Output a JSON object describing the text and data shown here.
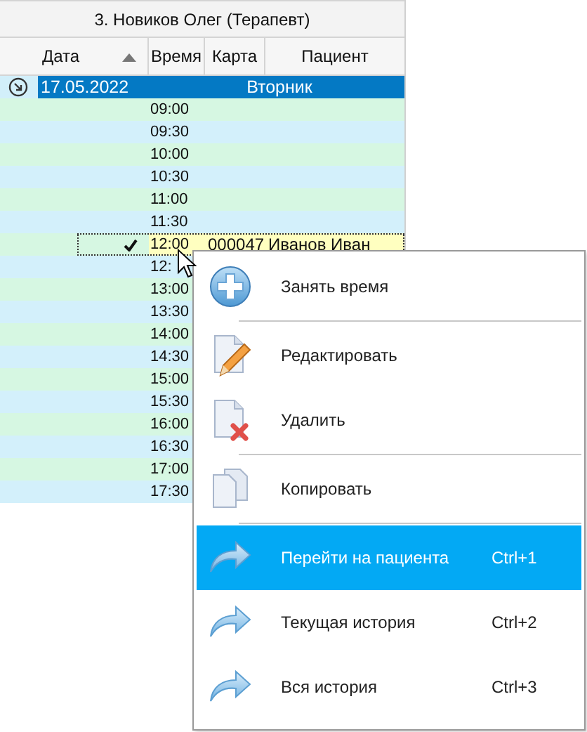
{
  "grid": {
    "title": "3. Новиков Олег (Терапевт)",
    "columns": [
      {
        "label": "Дата",
        "sorted": true
      },
      {
        "label": "Время",
        "sorted": false
      },
      {
        "label": "Карта",
        "sorted": false
      },
      {
        "label": "Пациент",
        "sorted": false
      }
    ],
    "group": {
      "date": "17.05.2022",
      "weekday": "Вторник",
      "selected": true
    },
    "rows": [
      {
        "time": "09:00",
        "selected": false,
        "checked": false
      },
      {
        "time": "09:30",
        "selected": false,
        "checked": false
      },
      {
        "time": "10:00",
        "selected": false,
        "checked": false
      },
      {
        "time": "10:30",
        "selected": false,
        "checked": false
      },
      {
        "time": "11:00",
        "selected": false,
        "checked": false
      },
      {
        "time": "11:30",
        "selected": false,
        "checked": false
      },
      {
        "time": "12:00",
        "card": "000047",
        "patient": "Иванов Иван",
        "selected": true,
        "checked": true
      },
      {
        "time": "12:",
        "selected": false,
        "checked": false
      },
      {
        "time": "13:00",
        "selected": false,
        "checked": false
      },
      {
        "time": "13:30",
        "selected": false,
        "checked": false
      },
      {
        "time": "14:00",
        "selected": false,
        "checked": false
      },
      {
        "time": "14:30",
        "selected": false,
        "checked": false
      },
      {
        "time": "15:00",
        "selected": false,
        "checked": false
      },
      {
        "time": "15:30",
        "selected": false,
        "checked": false
      },
      {
        "time": "16:00",
        "selected": false,
        "checked": false
      },
      {
        "time": "16:30",
        "selected": false,
        "checked": false
      },
      {
        "time": "17:00",
        "selected": false,
        "checked": false
      },
      {
        "time": "17:30",
        "selected": false,
        "checked": false
      }
    ]
  },
  "context_menu": {
    "items": [
      {
        "kind": "add",
        "label": "Занять время",
        "selected": false
      },
      {
        "kind": "separator"
      },
      {
        "kind": "edit",
        "label": "Редактировать",
        "selected": false
      },
      {
        "kind": "delete",
        "label": "Удалить",
        "selected": false
      },
      {
        "kind": "separator"
      },
      {
        "kind": "copy",
        "label": "Копировать",
        "selected": false
      },
      {
        "kind": "separator"
      },
      {
        "kind": "goto",
        "label": "Перейти на пациента",
        "shortcut": "Ctrl+1",
        "selected": true
      },
      {
        "kind": "goto",
        "label": "Текущая история",
        "shortcut": "Ctrl+2",
        "selected": false
      },
      {
        "kind": "goto",
        "label": "Вся история",
        "shortcut": "Ctrl+3",
        "selected": false
      }
    ]
  }
}
